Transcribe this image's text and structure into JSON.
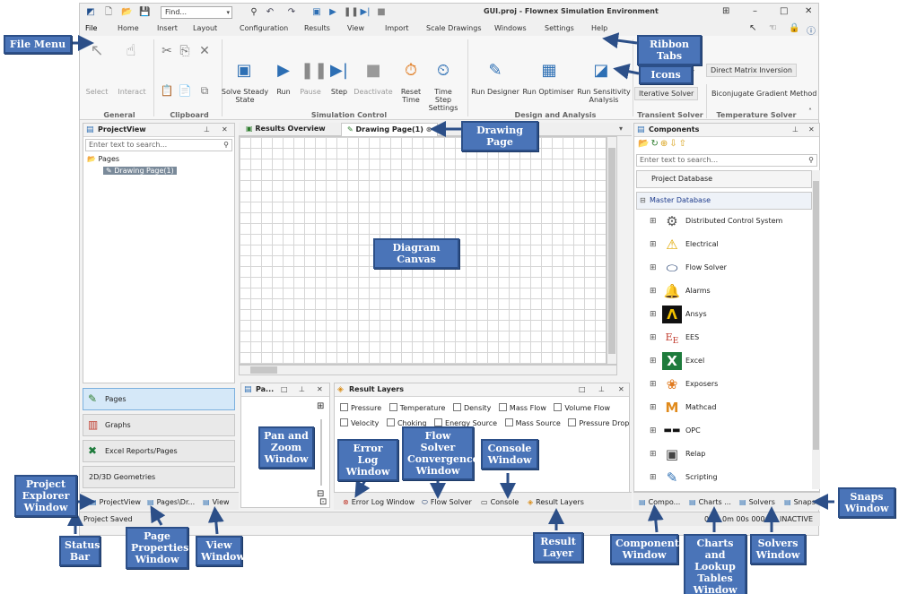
{
  "titlebar": {
    "find_label": "Find...",
    "title": "GUI.proj - Flownex Simulation Environment"
  },
  "ribbon_tabs": [
    "File",
    "Home",
    "Insert",
    "Layout",
    "Configuration",
    "Results",
    "View",
    "Import",
    "Scale Drawings",
    "Windows",
    "Settings",
    "Help"
  ],
  "ribbon": {
    "select": "Select",
    "interact": "Interact",
    "solve_steady_state": "Solve Steady State",
    "run": "Run",
    "pause": "Pause",
    "step": "Step",
    "deactivate": "Deactivate",
    "reset_time": "Reset Time",
    "time_step_settings": "Time Step Settings",
    "run_designer": "Run Designer",
    "run_optimiser": "Run Optimiser",
    "run_sensitivity_analysis": "Run Sensitivity Analysis",
    "steady_solver_partial": "ver",
    "direct_matrix_inversion": "Direct Matrix Inversion",
    "iterative_solver": "Iterative Solver",
    "biconjugate_gradient": "Biconjugate Gradient Method",
    "groups": {
      "general": "General",
      "clipboard": "Clipboard",
      "simulation_control": "Simulation Control",
      "design_analysis": "Design and Analysis",
      "transient_solver": "Transient Solver",
      "temperature_solver": "Temperature Solver"
    }
  },
  "project_view": {
    "title": "ProjectView",
    "search_placeholder": "Enter text to search...",
    "tree_root": "Pages",
    "tree_child": "Drawing Page(1)",
    "nav": [
      "Pages",
      "Graphs",
      "Excel Reports/Pages",
      "2D/3D Geometries"
    ]
  },
  "document_tabs": {
    "results_overview": "Results Overview",
    "drawing_page": "Drawing Page(1)"
  },
  "pan_zoom": {
    "title": "Pa..."
  },
  "result_layers": {
    "title": "Result Layers",
    "row1": [
      "Pressure",
      "Temperature",
      "Density",
      "Mass Flow",
      "Volume Flow"
    ],
    "row2": [
      "Velocity",
      "Choking",
      "Energy Source",
      "Mass Source",
      "Pressure Drop"
    ]
  },
  "bottom_tabs_left": [
    "ProjectView",
    "Pages\\Dr...",
    "View"
  ],
  "bottom_tabs_middle": [
    "Error Log Window",
    "Flow Solver",
    "Console",
    "Result Layers"
  ],
  "bottom_tabs_right": [
    "Compo...",
    "Charts ...",
    "Solvers",
    "Snaps"
  ],
  "components": {
    "title": "Components",
    "search_placeholder": "Enter text to search...",
    "project_database": "Project Database",
    "master_database": "Master Database",
    "items": [
      "Distributed Control System",
      "Electrical",
      "Flow Solver",
      "Alarms",
      "Ansys",
      "EES",
      "Excel",
      "Exposers",
      "Mathcad",
      "OPC",
      "Relap",
      "Scripting"
    ]
  },
  "status": {
    "left": "Project Saved",
    "right_time": "0",
    "right_time2": "0m 00s 000m",
    "right_state": "INACTIVE"
  },
  "annotations": {
    "file_menu": "File Menu",
    "ribbon_tabs": "Ribbon Tabs",
    "icons": "Icons",
    "drawing_page": "Drawing Page",
    "diagram_canvas": "Diagram Canvas",
    "pan_zoom": "Pan and Zoom Window",
    "error_log": "Error Log Window",
    "flow_solver": "Flow Solver Convergence Window",
    "console": "Console Window",
    "project_explorer": "Project Explorer Window",
    "status_bar": "Status Bar",
    "page_properties": "Page Properties Window",
    "view_window": "View Window",
    "result_layer": "Result Layer",
    "components_window": "Components Window",
    "charts_window": "Charts and Lookup Tables Window",
    "solvers_window": "Solvers Window",
    "snaps_window": "Snaps Window"
  },
  "colors": {
    "annotation_fill": "#4a74b8",
    "annotation_border": "#2c4f88",
    "accent_blue": "#2d6fb4"
  }
}
